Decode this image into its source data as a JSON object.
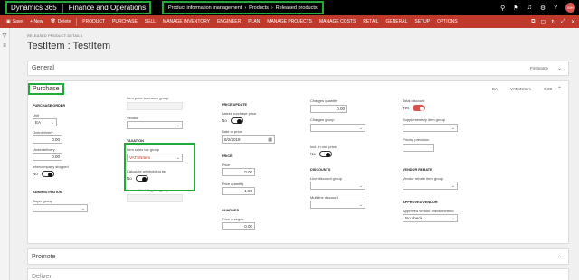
{
  "topbar": {
    "product": "Dynamics 365",
    "app": "Finance and Operations",
    "breadcrumb": [
      "Product information management",
      "Products",
      "Released products"
    ],
    "icons": [
      "search-icon",
      "flag-icon",
      "bell-icon",
      "settings-icon",
      "help-icon"
    ],
    "avatar_initials": "MH"
  },
  "actionbar": {
    "save": "Save",
    "new": "+ New",
    "delete": "Delete",
    "tabs": [
      "PRODUCT",
      "PURCHASE",
      "SELL",
      "MANAGE INVENTORY",
      "ENGINEER",
      "PLAN",
      "MANAGE PROJECTS",
      "MANAGE COSTS",
      "RETAIL",
      "GENERAL",
      "SETUP",
      "OPTIONS"
    ]
  },
  "page": {
    "header_small": "RELEASED PRODUCT DETAILS",
    "title": "TestItem : TestItem"
  },
  "general": {
    "title": "General",
    "right": "Firstname"
  },
  "purchase": {
    "title": "Purchase",
    "summary": [
      "EA",
      "VATSNItem",
      "0.00"
    ],
    "purchase_order": {
      "section": "PURCHASE ORDER",
      "unit_label": "Unit",
      "unit_value": "EA",
      "overdelivery_label": "Overdelivery",
      "overdelivery_value": "0.00",
      "underdelivery_label": "Underdelivery",
      "underdelivery_value": "0.00",
      "intercompany_label": "Intercompany stopped",
      "intercompany_value": "No"
    },
    "administration": {
      "section": "ADMINISTRATION",
      "buyer_label": "Buyer group"
    },
    "col2": {
      "price_tolerance_label": "Item price tolerance group",
      "vendor_label": "Vendor",
      "taxation_section": "TAXATION",
      "sales_tax_label": "Item sales tax group",
      "sales_tax_value": "VATSNItem",
      "calc_withholding_label": "Calculate withholding tax",
      "calc_withholding_value": "No",
      "withholding_label": "Item withholding tax group"
    },
    "col3": {
      "price_update_section": "PRICE UPDATE",
      "latest_price_label": "Latest purchase price",
      "latest_price_value": "No",
      "date_price_label": "Date of price",
      "date_price_value": "8/2/2018",
      "price_section": "PRICE",
      "price_label": "Price",
      "price_value": "0.00",
      "price_qty_label": "Price quantity",
      "price_qty_value": "1.00",
      "charges_section": "CHARGES",
      "price_charges_label": "Price charges",
      "price_charges_value": "0.00"
    },
    "col4": {
      "charges_qty_label": "Charges quantity",
      "charges_qty_value": "0.00",
      "charges_group_label": "Charges group",
      "incl_unit_price_label": "Incl. in unit price",
      "incl_unit_price_value": "No",
      "discounts_section": "DISCOUNTS",
      "line_discount_label": "Line discount group",
      "multiline_discount_label": "Multiline discount"
    },
    "col5": {
      "total_discount_label": "Total discount",
      "total_discount_value": "Yes",
      "supp_item_label": "Supplementary item group",
      "pricing_precision_label": "Pricing precision",
      "vendor_rebate_section": "VENDOR REBATE",
      "vendor_rebate_label": "Vendor rebate item group",
      "approved_vendor_section": "APPROVED VENDOR",
      "approved_vendor_label": "Approved vendor check method",
      "approved_vendor_value": "No check"
    }
  },
  "promote": {
    "title": "Promote"
  },
  "deliver": {
    "title": "Deliver"
  },
  "colors": {
    "accent": "#c0392b",
    "highlight": "#1faa3a"
  }
}
